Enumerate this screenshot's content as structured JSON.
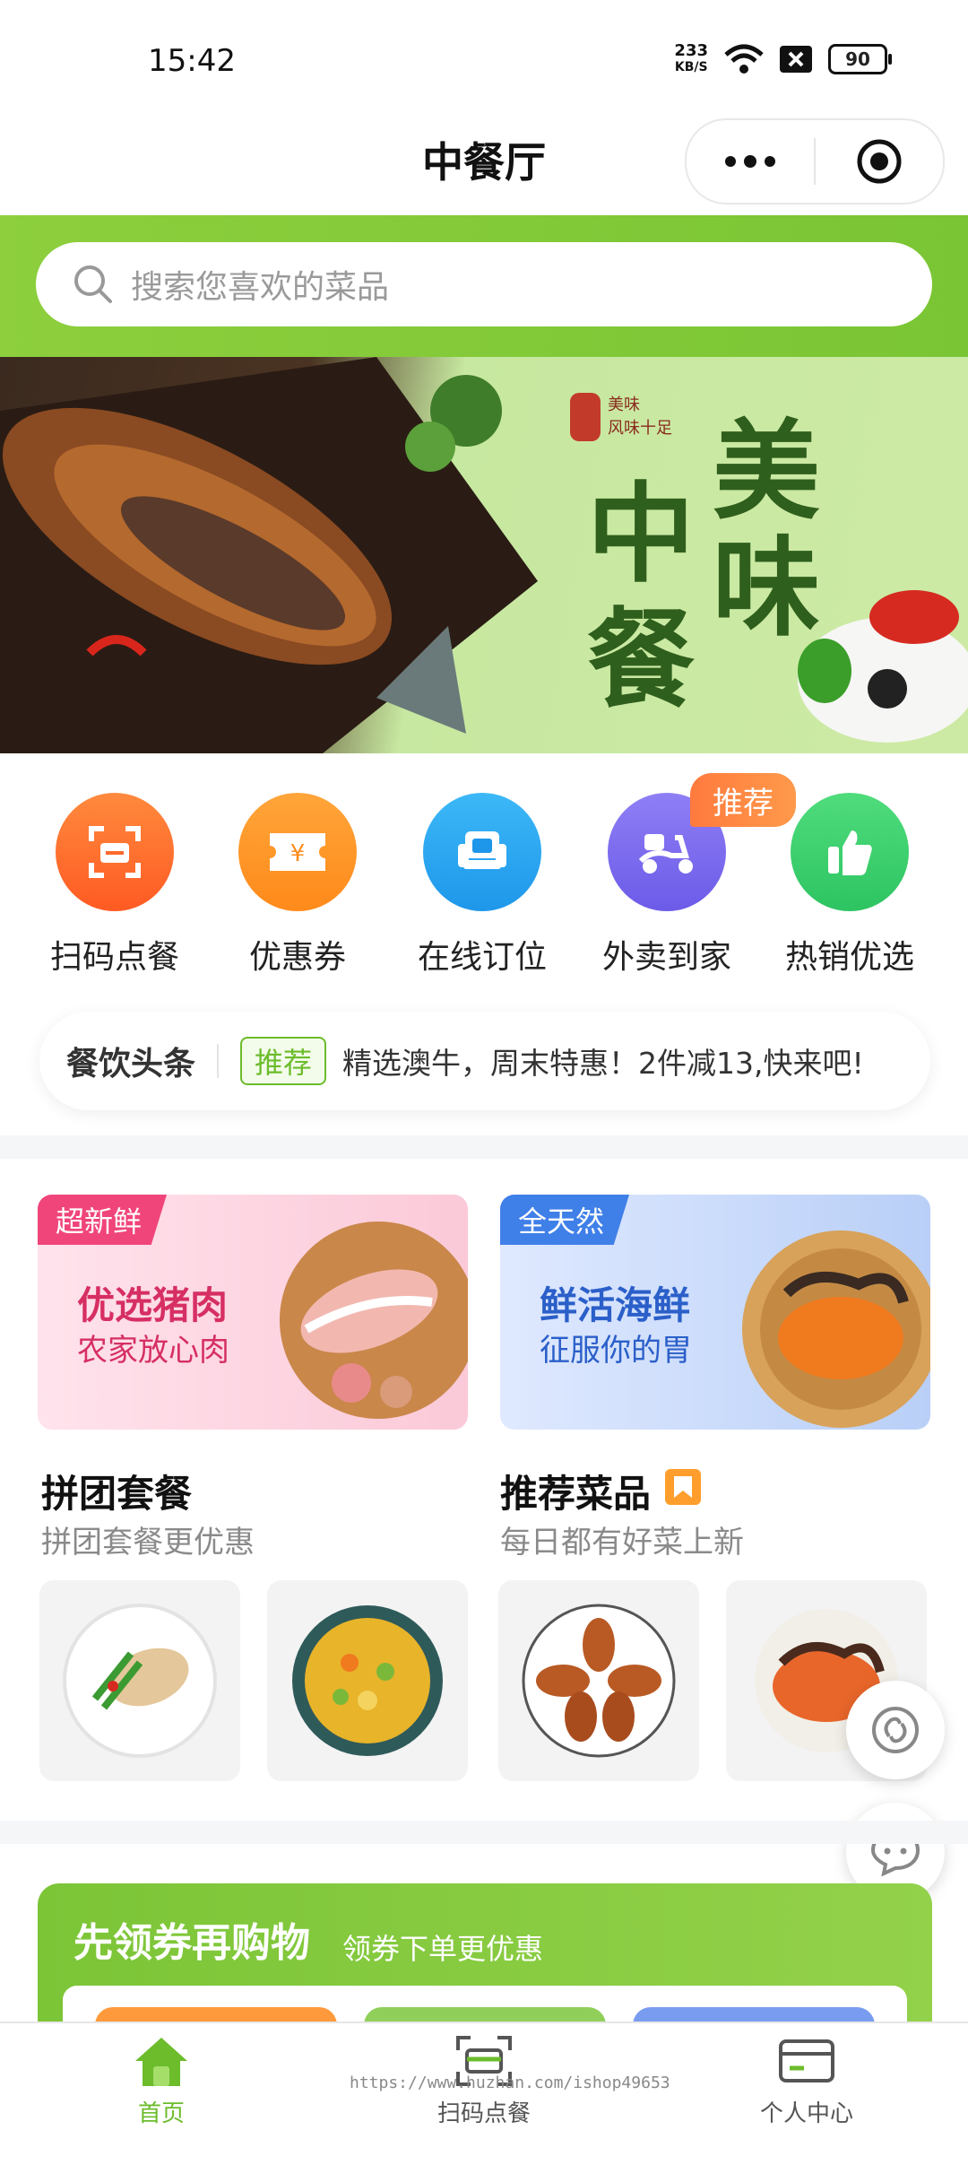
{
  "status_bar": {
    "time": "15:42",
    "net_speed_value": "233",
    "net_speed_unit": "KB/S",
    "battery": "90"
  },
  "header": {
    "title": "中餐厅"
  },
  "search": {
    "placeholder": "搜索您喜欢的菜品"
  },
  "banner": {
    "seal_line1": "美味",
    "seal_line2": "风味十足",
    "char_mei": "美",
    "char_wei": "味",
    "char_zhong": "中",
    "char_can": "餐"
  },
  "quick_nav": [
    {
      "label": "扫码点餐",
      "icon": "scan-icon",
      "color": "#ff6a2c"
    },
    {
      "label": "优惠券",
      "icon": "coupon-icon",
      "color": "#ff8f1f"
    },
    {
      "label": "在线订位",
      "icon": "seat-icon",
      "color": "#29a8f0"
    },
    {
      "label": "外卖到家",
      "icon": "scooter-icon",
      "color": "#7b6cf0"
    },
    {
      "label": "热销优选",
      "icon": "thumbs-up-icon",
      "color": "#3ccf6a"
    }
  ],
  "nav_badge": "推荐",
  "headline": {
    "title": "餐饮头条",
    "tag": "推荐",
    "text": "精选澳牛，周末特惠！2件减13,快来吧!"
  },
  "promos": [
    {
      "tag": "超新鲜",
      "title": "优选猪肉",
      "subtitle": "农家放心肉",
      "tag_color": "#f0457a",
      "title_color": "#d62f63"
    },
    {
      "tag": "全天然",
      "title": "鲜活海鲜",
      "subtitle": "征服你的胃",
      "tag_color": "#3f7fe8",
      "title_color": "#2b5fc9"
    }
  ],
  "sections": [
    {
      "title": "拼团套餐",
      "subtitle": "拼团套餐更优惠"
    },
    {
      "title": "推荐菜品",
      "subtitle": "每日都有好菜上新"
    }
  ],
  "coupon": {
    "title": "先领券再购物",
    "subtitle": "领券下单更优惠"
  },
  "tabbar": [
    {
      "label": "首页",
      "icon": "home-icon",
      "active": true
    },
    {
      "label": "扫码点餐",
      "icon": "scan-icon",
      "active": false
    },
    {
      "label": "个人中心",
      "icon": "card-icon",
      "active": false
    }
  ],
  "watermark": "https://www.huzhan.com/ishop49653",
  "colors": {
    "brand_green": "#7ac534",
    "tab_active": "#6cbc2c"
  }
}
